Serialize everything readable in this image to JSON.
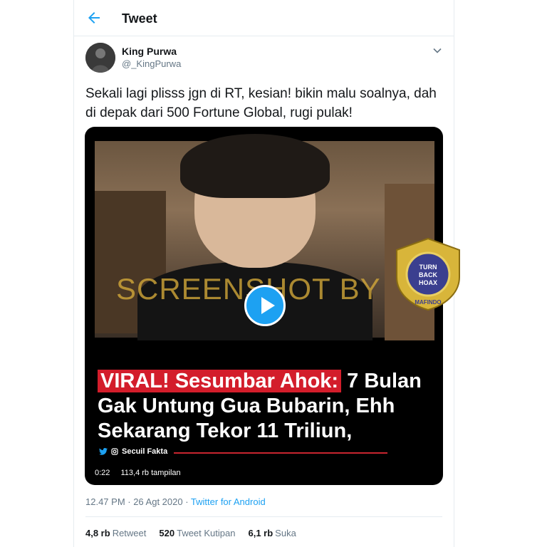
{
  "header": {
    "title": "Tweet"
  },
  "user": {
    "name": "King Purwa",
    "handle": "@_KingPurwa"
  },
  "tweet_text": "Sekali lagi plisss jgn di RT, kesian! bikin malu soalnya, dah di depak dari 500 Fortune Global, rugi pulak!",
  "media": {
    "watermark": "SCREENSHOT BY",
    "caption_highlight": "VIRAL! Sesumbar Ahok:",
    "caption_rest_1": " 7 Bulan",
    "caption_line_2": "Gak Untung Gua Bubarin, Ehh",
    "caption_line_3": "Sekarang Tekor 11 Triliun,",
    "source": "Secuil Fakta",
    "duration": "0:22",
    "views": "113,4 rb tampilan"
  },
  "badge": {
    "text": "TURN BACK HOAX",
    "org": "MAFINDO"
  },
  "meta": {
    "time": "12.47 PM · 26 Agt 2020 · ",
    "client": "Twitter for Android"
  },
  "stats": {
    "retweets_value": "4,8 rb",
    "retweets_label": "Retweet",
    "quotes_value": "520",
    "quotes_label": "Tweet Kutipan",
    "likes_value": "6,1 rb",
    "likes_label": "Suka"
  },
  "colors": {
    "accent": "#1da1f2",
    "highlight": "#d31d2b",
    "watermark": "#d6aa3a"
  },
  "icons": {
    "back": "arrow-left-icon",
    "menu": "chevron-down-icon",
    "play": "play-icon"
  }
}
